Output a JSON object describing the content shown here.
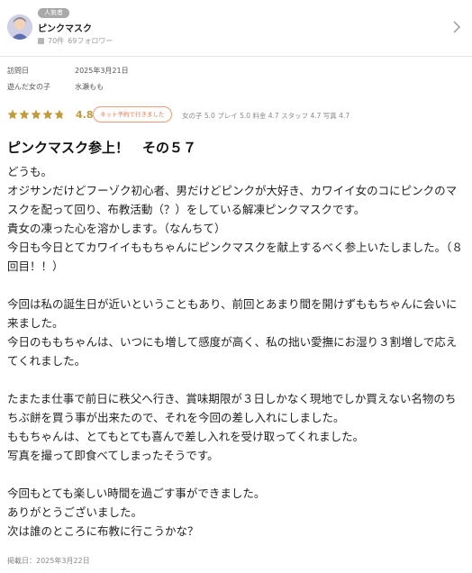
{
  "reviewer": {
    "rank_badge": "人気者",
    "name": "ピンクマスク",
    "reviews_count": "70件",
    "followers": "69フォロワー"
  },
  "visit": {
    "date_label": "訪問日",
    "date_value": "2025年3月21日",
    "girl_label": "遊んだ女の子",
    "girl_value": "水瀬もも"
  },
  "rating": {
    "score": "4.8",
    "stars_value": 4.8,
    "stars_max": 5,
    "star_color": "#c19a3a",
    "reserve_badge": "ネット予約で行きました",
    "subscores": "女の子 5.0 プレイ 5.0 料金 4.7 スタッフ 4.7 写真 4.7"
  },
  "review": {
    "title": "ピンクマスク参上！　その５７",
    "body": "どうも。\nオジサンだけどフーゾク初心者、男だけどピンクが大好き、カワイイ女のコにピンクのマスクを配って回り、布教活動（？）をしている解凍ピンクマスクです。\n貴女の凍った心を溶かします。（なんちて）\n今日も今日とてカワイイももちゃんにピンクマスクを献上するべく参上いたしました。（８回目！！）\n\n今回は私の誕生日が近いということもあり、前回とあまり間を開けずももちゃんに会いに来ました。\n今日のももちゃんは、いつにも増して感度が高く、私の拙い愛撫にお湿り３割増しで応えてくれました。\n\nたまたま仕事で前日に秩父へ行き、賞味期限が３日しかなく現地でしか買えない名物のちちぶ餅を買う事が出来たので、それを今回の差し入れにしました。\nももちゃんは、とてもとても喜んで差し入れを受け取ってくれました。\n写真を撮って即食べてしまったそうです。\n\n今回もとても楽しい時間を過ごす事ができました。\nありがとうございました。\n次は誰のところに布教に行こうかな？",
    "posted": "掲載日：2025年3月22日"
  }
}
